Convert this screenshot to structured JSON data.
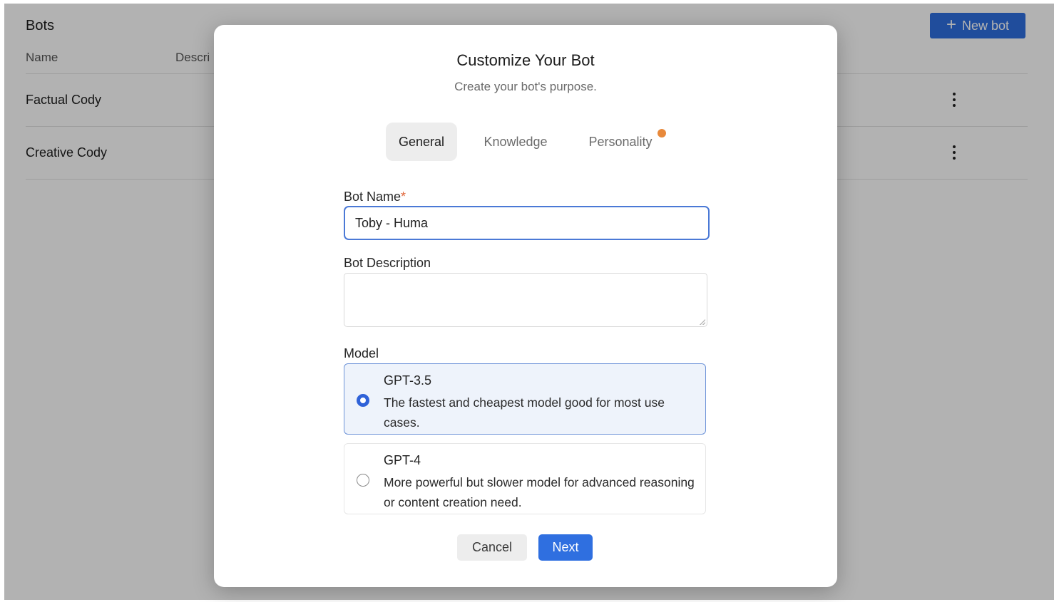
{
  "app": {
    "title": "Bots",
    "new_bot_label": "New bot",
    "columns": [
      "Name",
      "Descri"
    ],
    "bots": [
      {
        "name": "Factual Cody"
      },
      {
        "name": "Creative Cody"
      }
    ]
  },
  "modal": {
    "title": "Customize Your Bot",
    "subtitle": "Create your bot's purpose.",
    "tabs": [
      {
        "label": "General",
        "active": true
      },
      {
        "label": "Knowledge",
        "active": false
      },
      {
        "label": "Personality",
        "active": false,
        "has_notification": true
      }
    ],
    "bot_name": {
      "label": "Bot Name",
      "required_mark": "*",
      "value": "Toby - Huma"
    },
    "bot_description": {
      "label": "Bot Description",
      "value": ""
    },
    "model": {
      "label": "Model",
      "options": [
        {
          "name": "GPT-3.5",
          "description": "The fastest and cheapest model good for most use cases.",
          "selected": true
        },
        {
          "name": "GPT-4",
          "description": "More powerful but slower model for advanced reasoning or content creation need.",
          "selected": false
        }
      ]
    },
    "cancel_label": "Cancel",
    "next_label": "Next"
  },
  "colors": {
    "primary": "#2f6fe0",
    "notification_dot": "#e8893b",
    "required": "#e0663a"
  }
}
